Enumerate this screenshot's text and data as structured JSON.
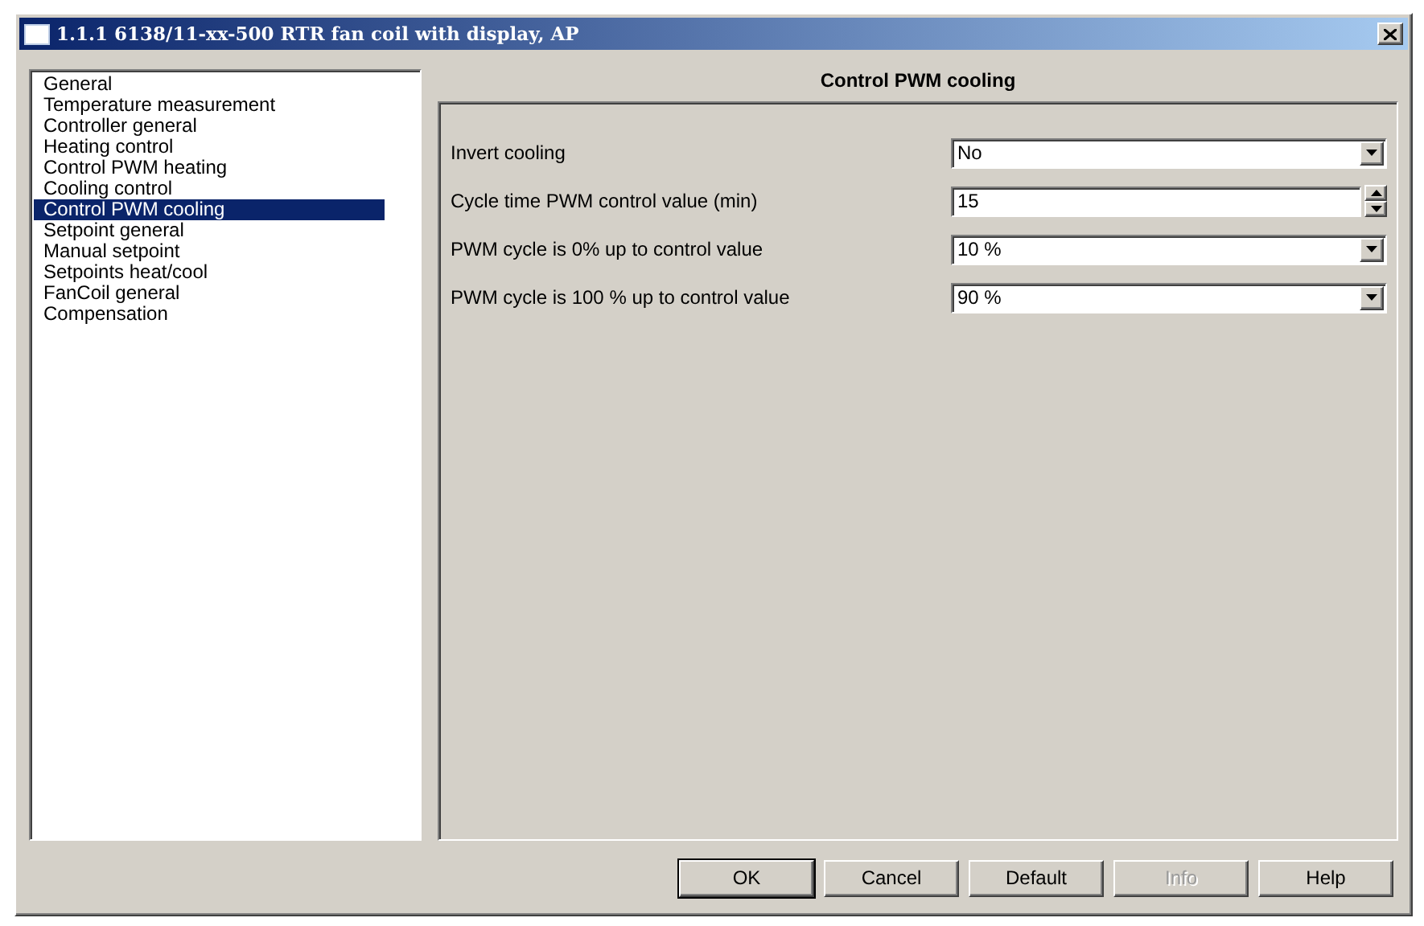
{
  "window": {
    "title": "1.1.1 6138/11-xx-500 RTR fan coil with display, AP"
  },
  "sidebar": {
    "items": [
      {
        "label": "General",
        "selected": false
      },
      {
        "label": "Temperature measurement",
        "selected": false
      },
      {
        "label": "Controller general",
        "selected": false
      },
      {
        "label": "Heating control",
        "selected": false
      },
      {
        "label": "Control PWM heating",
        "selected": false
      },
      {
        "label": "Cooling control",
        "selected": false
      },
      {
        "label": "Control PWM cooling",
        "selected": true
      },
      {
        "label": "Setpoint general",
        "selected": false
      },
      {
        "label": "Manual setpoint",
        "selected": false
      },
      {
        "label": "Setpoints heat/cool",
        "selected": false
      },
      {
        "label": "FanCoil general",
        "selected": false
      },
      {
        "label": "Compensation",
        "selected": false
      }
    ]
  },
  "panel": {
    "title": "Control PWM cooling",
    "parameters": [
      {
        "label": "Invert cooling",
        "kind": "dropdown",
        "value": "No"
      },
      {
        "label": "Cycle time PWM control value (min)",
        "kind": "spinner",
        "value": "15"
      },
      {
        "label": "PWM cycle is 0% up to control value",
        "kind": "dropdown",
        "value": "10 %"
      },
      {
        "label": "PWM cycle is 100 % up to control value",
        "kind": "dropdown",
        "value": "90 %"
      }
    ]
  },
  "buttons": [
    {
      "label": "OK",
      "disabled": false
    },
    {
      "label": "Cancel",
      "disabled": false
    },
    {
      "label": "Default",
      "disabled": false
    },
    {
      "label": "Info",
      "disabled": true
    },
    {
      "label": "Help",
      "disabled": false
    }
  ]
}
